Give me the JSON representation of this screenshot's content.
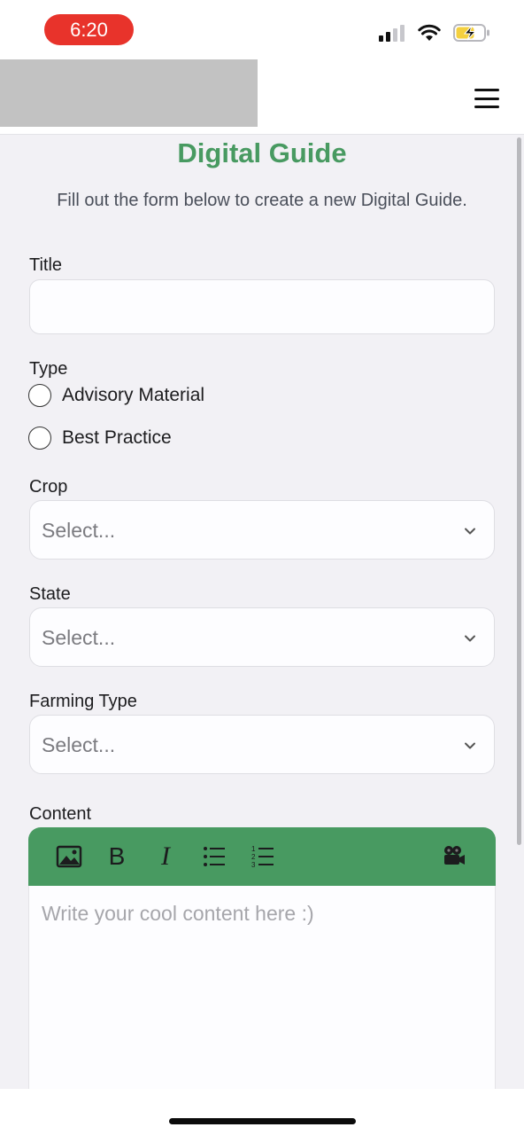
{
  "status_bar": {
    "time": "6:20"
  },
  "header": {
    "menu_icon": "hamburger-menu-icon"
  },
  "page": {
    "title": "Digital Guide",
    "subtitle": "Fill out the form below to create a new Digital Guide."
  },
  "form": {
    "title_label": "Title",
    "title_value": "",
    "type_label": "Type",
    "type_options": [
      "Advisory Material",
      "Best Practice"
    ],
    "crop_label": "Crop",
    "crop_placeholder": "Select...",
    "state_label": "State",
    "state_placeholder": "Select...",
    "farming_type_label": "Farming Type",
    "farming_type_placeholder": "Select...",
    "content_label": "Content",
    "content_placeholder": "Write your cool content here :)"
  },
  "toolbar": {
    "bold": "B",
    "italic": "I",
    "icons": [
      "image-icon",
      "bold-icon",
      "italic-icon",
      "bullet-list-icon",
      "numbered-list-icon",
      "video-camera-icon"
    ]
  },
  "colors": {
    "accent": "#489a61",
    "time_pill": "#e8332b",
    "battery": "#f4d03f"
  }
}
